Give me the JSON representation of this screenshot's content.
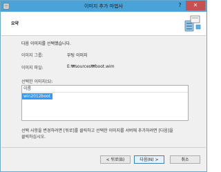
{
  "window": {
    "title": "이미지 추가 마법사"
  },
  "titlebar": {
    "help": "?",
    "close": "✕"
  },
  "header": {
    "title": "요약"
  },
  "content": {
    "intro": "다음 이미지를 선택했습니다.",
    "group_label": "이미지 그룹:",
    "group_value": "부팅 이미지",
    "file_label": "이미지 파일:",
    "file_value": "E:₩sources₩boot.wim",
    "selected_label": "선택한 이미지(S):",
    "list_header": "이름",
    "list_items": [
      "win2012boot"
    ],
    "note_line1": "선택 사항을 변경하려면 [뒤로]를 클릭하고 선택한 이미지를 서버에 추가하려면 [다음]을",
    "note_line2": "클릭하십시오."
  },
  "buttons": {
    "back": "< 뒤로(B)",
    "next": "다음(N) >",
    "cancel": "취소"
  },
  "colors": {
    "titlebar": "#4aa3d8",
    "selection": "#3399ff",
    "close": "#c75050"
  }
}
